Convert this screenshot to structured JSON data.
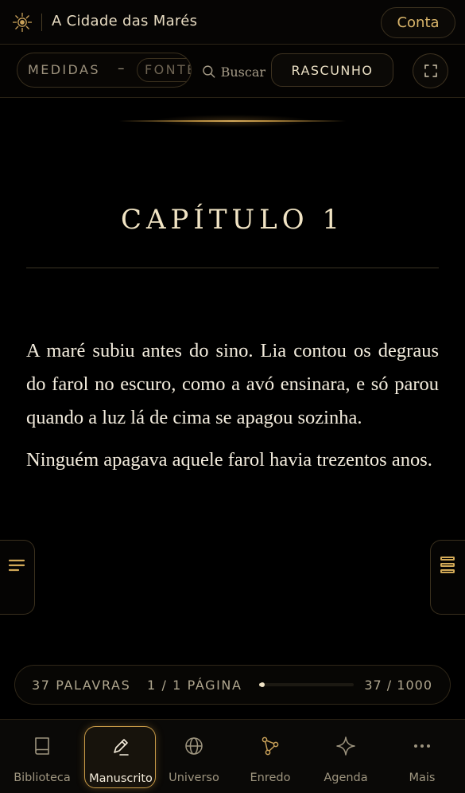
{
  "header": {
    "title": "A Cidade das Marés",
    "account_label": "Conta"
  },
  "toolbar": {
    "measures_label": "MEDIDAS",
    "minus_label": "–",
    "font_label": "FONTE",
    "search_label": "Buscar",
    "draft_label": "RASCUNHO"
  },
  "manuscript": {
    "chapter_title": "CAPÍTULO 1",
    "paragraphs": [
      "A maré subiu antes do sino. Lia contou os degraus do farol no escuro, como a avó ensinara, e só parou quando a luz lá de cima se apagou sozinha.",
      "Ninguém apagava aquele farol havia trezentos anos."
    ]
  },
  "status": {
    "words": "37 PALAVRAS",
    "page": "1 / 1 PÁGINA",
    "count": "37 / 1000",
    "progress_fraction": 0.037
  },
  "nav": {
    "items": [
      {
        "label": "Biblioteca",
        "icon": "book-icon"
      },
      {
        "label": "Manuscrito",
        "icon": "pen-icon",
        "active": true
      },
      {
        "label": "Universo",
        "icon": "globe-icon"
      },
      {
        "label": "Enredo",
        "icon": "plot-nodes-icon"
      },
      {
        "label": "Agenda",
        "icon": "sparkle-icon"
      },
      {
        "label": "Mais",
        "icon": "more-dots-icon"
      }
    ]
  },
  "colors": {
    "accent_gold": "#d8b46a",
    "background": "#000000",
    "text": "#f3ecdd"
  }
}
